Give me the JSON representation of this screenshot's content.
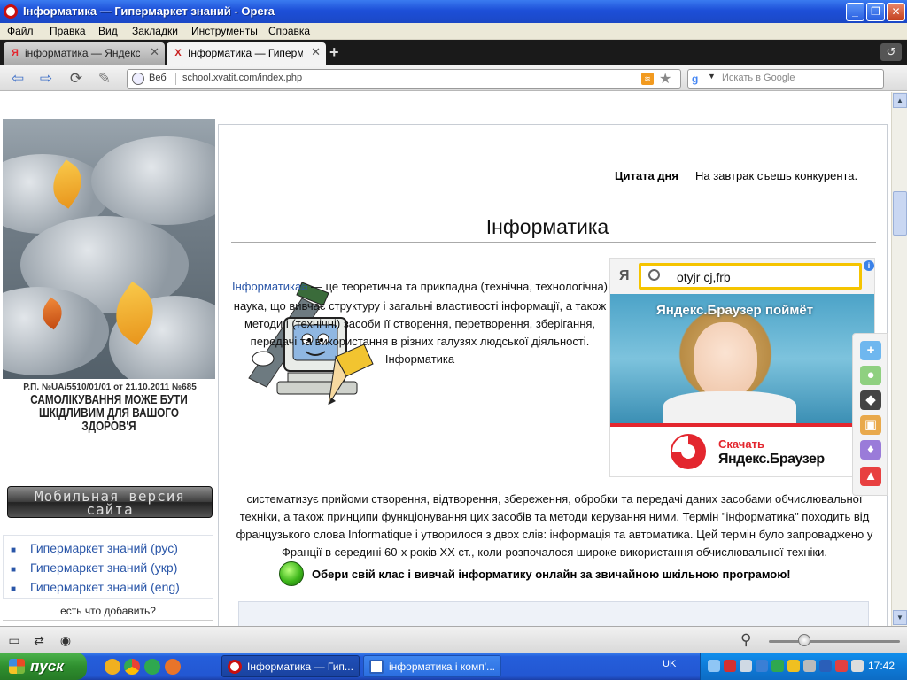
{
  "window": {
    "title": "Інформатика — Гипермаркет знаний - Opera"
  },
  "menu": [
    "Файл",
    "Правка",
    "Вид",
    "Закладки",
    "Инструменты",
    "Справка"
  ],
  "tabs": [
    {
      "label": "інформатика — Яндекс...",
      "favicon": "Я",
      "active": false
    },
    {
      "label": "Інформатика — Гиперм...",
      "favicon": "X",
      "active": true
    }
  ],
  "address": {
    "web_label": "Веб",
    "url": "school.xvatit.com/index.php",
    "search_placeholder": "Искать в Google"
  },
  "sidebar": {
    "reg_number": "Р.П. №UA/5510/01/01 от 21.10.2011 №685",
    "warning": "САМОЛІКУВАННЯ МОЖЕ БУТИ ШКІДЛИВИМ ДЛЯ ВАШОГО ЗДОРОВ'Я",
    "mobile_button": "Мобильная версия сайта",
    "links": [
      "Гипермаркет знаний (рус)",
      "Гипермаркет знаний (укр)",
      "Гипермаркет знаний (eng)"
    ],
    "add_note": "есть что добавить?"
  },
  "main": {
    "quote_label": "Цитата дня",
    "quote_text": "На завтрак съешь конкурента.",
    "heading": "Інформатика",
    "link_word": "Інформатика",
    "para1": " — це теоретична та прикладна (технічна, технологічна) наука, що вивчає структуру і загальні властивості інформації, а також методи і (технічні) засоби її створення, перетворення, зберігання, передачі та використання в різних галузях людської діяльності. Інформатика",
    "para2": "систематизує прийоми створення, відтворення, збереження, обробки та передачі даних засобами обчислювальної техніки, а також принципи функціонування цих засобів та методи керування ними. Термін \"інформатика\" походить від французького слова Informatique і утворилося з двох слів: інформація та автоматика. Цей термін було запроваджено у Франції в середині 60-х років XX ст., коли розпочалося широке використання обчислювальної техніки.",
    "cta": "Обери свій клас і вивчай інформатику онлайн за звичайною шкільною програмою!"
  },
  "ad": {
    "yandex_letter": "Я",
    "query": "otyjr cj,frb",
    "headline": "Яндекс.Браузер поймёт",
    "download": "Скачать",
    "product": "Яндекс.Браузер"
  },
  "taskbar": {
    "start": "пуск",
    "tasks": [
      "Інформатика — Гип...",
      "інформатика і комп'..."
    ],
    "language": "UK",
    "clock": "17:42"
  }
}
